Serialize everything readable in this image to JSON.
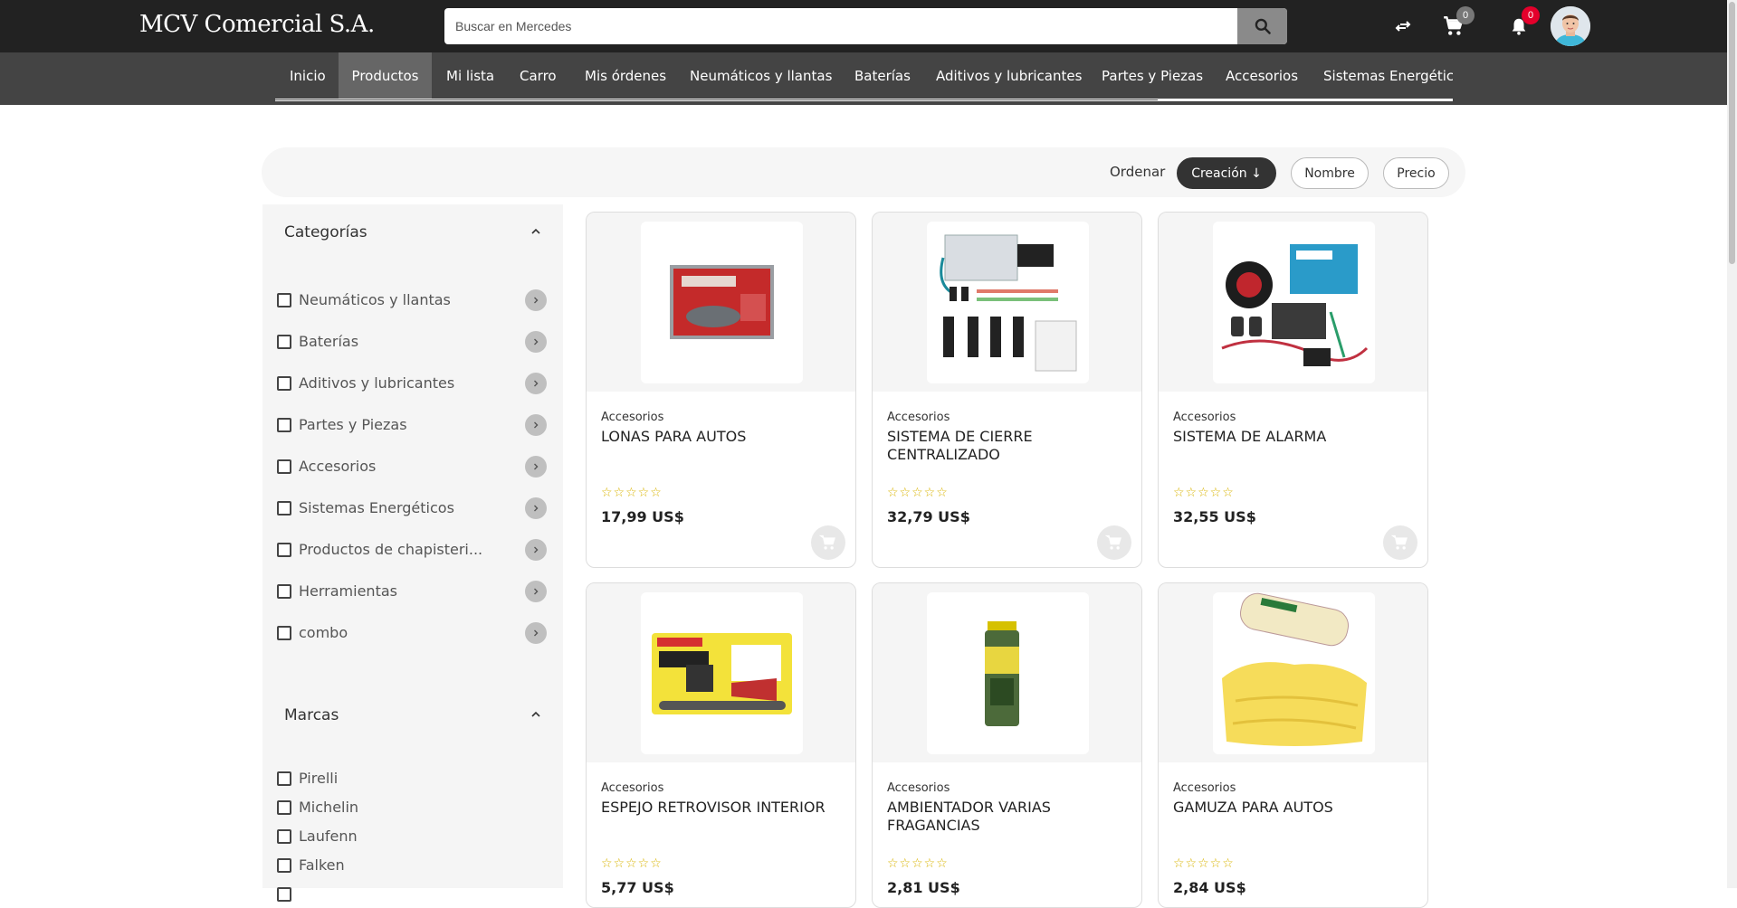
{
  "header": {
    "logo": "MCV Comercial S.A.",
    "search_placeholder": "Buscar en Mercedes",
    "compare_icon": "compare-arrows-icon",
    "cart_count": "0",
    "notifications_count": "0",
    "accent_color": "#e4002b"
  },
  "nav": {
    "items": [
      {
        "label": "Inicio"
      },
      {
        "label": "Productos",
        "active": true
      },
      {
        "label": "Mi lista"
      },
      {
        "label": "Carro"
      },
      {
        "label": "Mis órdenes"
      },
      {
        "label": "Neumáticos y llantas"
      },
      {
        "label": "Baterías"
      },
      {
        "label": "Aditivos y lubricantes"
      },
      {
        "label": "Partes y Piezas"
      },
      {
        "label": "Accesorios"
      },
      {
        "label": "Sistemas Energéticos"
      }
    ]
  },
  "sort": {
    "label": "Ordenar",
    "options": [
      "Creación ↓",
      "Nombre",
      "Precio"
    ],
    "selected": "Creación ↓"
  },
  "sidebar": {
    "categories_title": "Categorías",
    "categories": [
      "Neumáticos y llantas",
      "Baterías",
      "Aditivos y lubricantes",
      "Partes y Piezas",
      "Accesorios",
      "Sistemas Energéticos",
      "Productos de chapisteri...",
      "Herramientas",
      "combo"
    ],
    "brands_title": "Marcas",
    "brands": [
      "Pirelli",
      "Michelin",
      "Laufenn",
      "Falken"
    ]
  },
  "products": [
    {
      "category": "Accesorios",
      "name": "LONAS PARA AUTOS",
      "rating_stars": "☆☆☆☆☆",
      "price": "17,99 US$"
    },
    {
      "category": "Accesorios",
      "name": "SISTEMA DE CIERRE CENTRALIZADO",
      "rating_stars": "☆☆☆☆☆",
      "price": "32,79 US$"
    },
    {
      "category": "Accesorios",
      "name": "SISTEMA DE ALARMA",
      "rating_stars": "☆☆☆☆☆",
      "price": "32,55 US$"
    },
    {
      "category": "Accesorios",
      "name": "ESPEJO RETROVISOR INTERIOR",
      "rating_stars": "☆☆☆☆☆",
      "price": "5,77 US$"
    },
    {
      "category": "Accesorios",
      "name": "AMBIENTADOR VARIAS FRAGANCIAS",
      "rating_stars": "☆☆☆☆☆",
      "price": "2,81 US$"
    },
    {
      "category": "Accesorios",
      "name": "GAMUZA PARA AUTOS",
      "rating_stars": "☆☆☆☆☆",
      "price": "2,84 US$"
    }
  ]
}
